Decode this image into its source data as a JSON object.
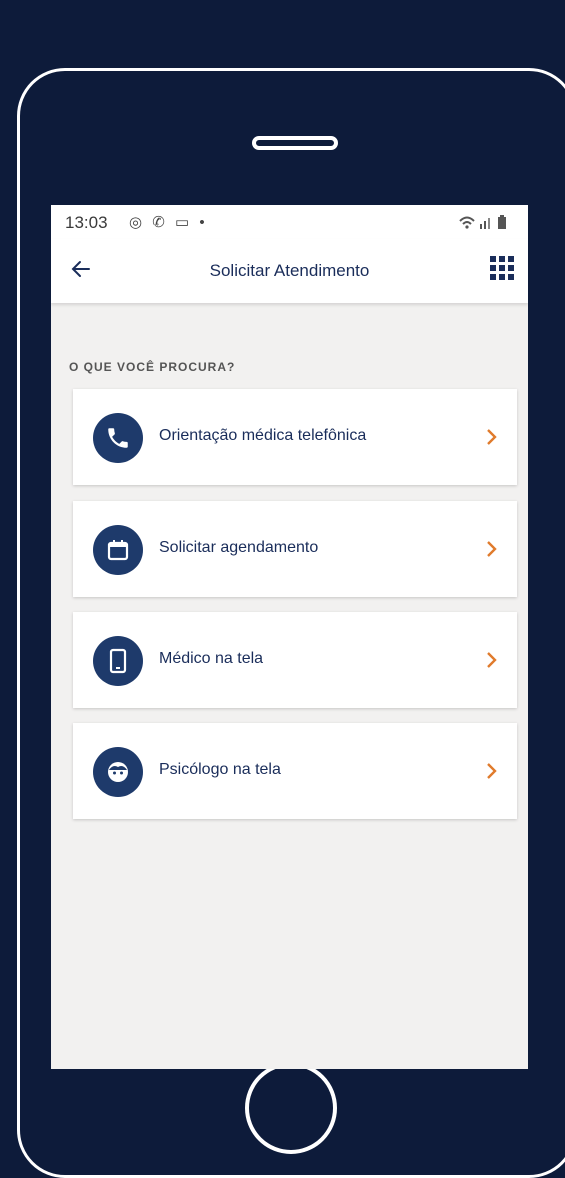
{
  "status_bar": {
    "time": "13:03",
    "icons": "◎ ✆ ▭ •",
    "right_icons": "wifi signal battery"
  },
  "app_bar": {
    "title": "Solicitar Atendimento",
    "back_icon": "arrow-left-icon",
    "menu_icon": "grid-icon"
  },
  "section": {
    "label": "O QUE VOCÊ PROCURA?"
  },
  "options": [
    {
      "label": "Orientação médica telefônica",
      "icon": "phone-icon"
    },
    {
      "label": "Solicitar agendamento",
      "icon": "calendar-icon"
    },
    {
      "label": "Médico na tela",
      "icon": "smartphone-icon"
    },
    {
      "label": "Psicólogo na tela",
      "icon": "face-icon"
    }
  ],
  "colors": {
    "background": "#0d1b3a",
    "primary": "#1e3a6b",
    "accent": "#e07b2c",
    "screen_bg": "#f2f1f0"
  }
}
